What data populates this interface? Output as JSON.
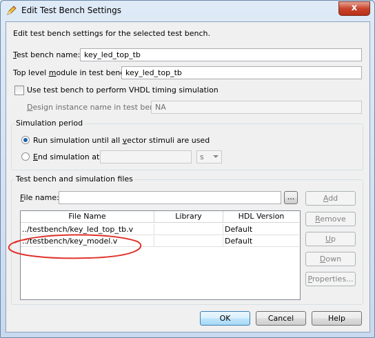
{
  "window": {
    "title": "Edit Test Bench Settings",
    "close_glyph": "x"
  },
  "description": "Edit test bench settings for the selected test bench.",
  "test_bench_name": {
    "label_pre": "T",
    "label_rest": "est bench name:",
    "value": "key_led_top_tb"
  },
  "top_level_module": {
    "label_pre": "Top level ",
    "label_u": "m",
    "label_rest": "odule in test bench:",
    "value": "key_led_top_tb"
  },
  "vhdl_timing": {
    "label": "Use test bench to perform VHDL timing simulation",
    "checked": false
  },
  "design_instance": {
    "label_u": "D",
    "label_rest": "esign instance name in test bench:",
    "value": "NA"
  },
  "simulation_period": {
    "title": "Simulation period",
    "run_all": {
      "label_pre": "Run simulation until all ",
      "label_u": "v",
      "label_rest": "ector stimuli are used",
      "selected": true
    },
    "end_at": {
      "label_u": "E",
      "label_rest": "nd simulation at:",
      "selected": false,
      "value": "",
      "unit": "s"
    }
  },
  "files_group": {
    "title": "Test bench and simulation files",
    "file_name": {
      "label_pre": "",
      "label_u": "F",
      "label_rest": "ile name:",
      "value": "",
      "browse": "..."
    },
    "columns": [
      "File Name",
      "Library",
      "HDL Version"
    ],
    "rows": [
      {
        "file": "../testbench/key_led_top_tb.v",
        "library": "",
        "hdl": "Default"
      },
      {
        "file": "../testbench/key_model.v",
        "library": "",
        "hdl": "Default"
      }
    ],
    "buttons": {
      "add": {
        "u": "A",
        "rest": "dd"
      },
      "remove": {
        "u": "R",
        "rest": "emove"
      },
      "up": {
        "u": "U",
        "rest": "p"
      },
      "down": {
        "u": "D",
        "rest": "own"
      },
      "properties": {
        "u": "P",
        "rest": "roperties..."
      }
    }
  },
  "footer": {
    "ok": "OK",
    "cancel": "Cancel",
    "help": "Help"
  },
  "annotation_color": "#e0322a"
}
